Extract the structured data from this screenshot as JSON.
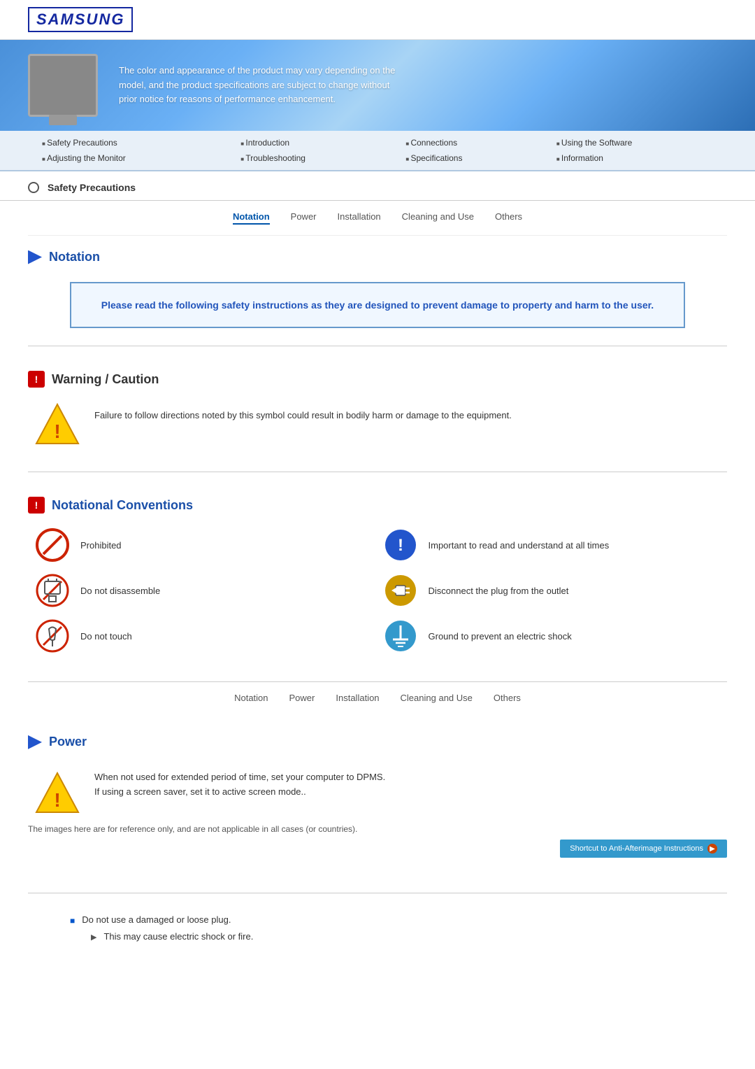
{
  "header": {
    "logo": "SAMSUNG"
  },
  "banner": {
    "text": "The color and appearance of the product may vary depending on the model, and the product specifications are subject to change without prior notice for reasons of performance enhancement."
  },
  "nav": {
    "items": [
      [
        "Safety Precautions",
        "Introduction",
        "Connections",
        "Using the Software"
      ],
      [
        "Adjusting the Monitor",
        "Troubleshooting",
        "Specifications",
        "Information"
      ]
    ]
  },
  "breadcrumb": {
    "label": "Safety Precautions"
  },
  "tabs": {
    "items": [
      "Notation",
      "Power",
      "Installation",
      "Cleaning and Use",
      "Others"
    ],
    "active": 0
  },
  "notation_section": {
    "title": "Notation",
    "info_box_text": "Please read the following safety instructions as they are designed to prevent damage to property and harm to the user."
  },
  "warning_section": {
    "title": "Warning / Caution",
    "text": "Failure to follow directions noted by this symbol could result in bodily harm or damage to the equipment."
  },
  "conventions_section": {
    "title": "Notational Conventions",
    "items_left": [
      {
        "label": "Prohibited"
      },
      {
        "label": "Do not disassemble"
      },
      {
        "label": "Do not touch"
      }
    ],
    "items_right": [
      {
        "label": "Important to read and understand at all times"
      },
      {
        "label": "Disconnect the plug from the outlet"
      },
      {
        "label": "Ground to prevent an electric shock"
      }
    ]
  },
  "bottom_tabs": {
    "items": [
      "Notation",
      "Power",
      "Installation",
      "Cleaning and Use",
      "Others"
    ]
  },
  "power_section": {
    "title": "Power",
    "warning_text": "When not used for extended period of time, set your computer to DPMS.\nIf using a screen saver, set it to active screen mode..",
    "reference_text": "The images here are for reference only, and are not applicable in all cases (or countries).",
    "shortcut_label": "Shortcut to Anti-Afterimage Instructions",
    "bullet1": "Do not use a damaged or loose plug.",
    "sub_bullet1": "This may cause electric shock or fire."
  }
}
